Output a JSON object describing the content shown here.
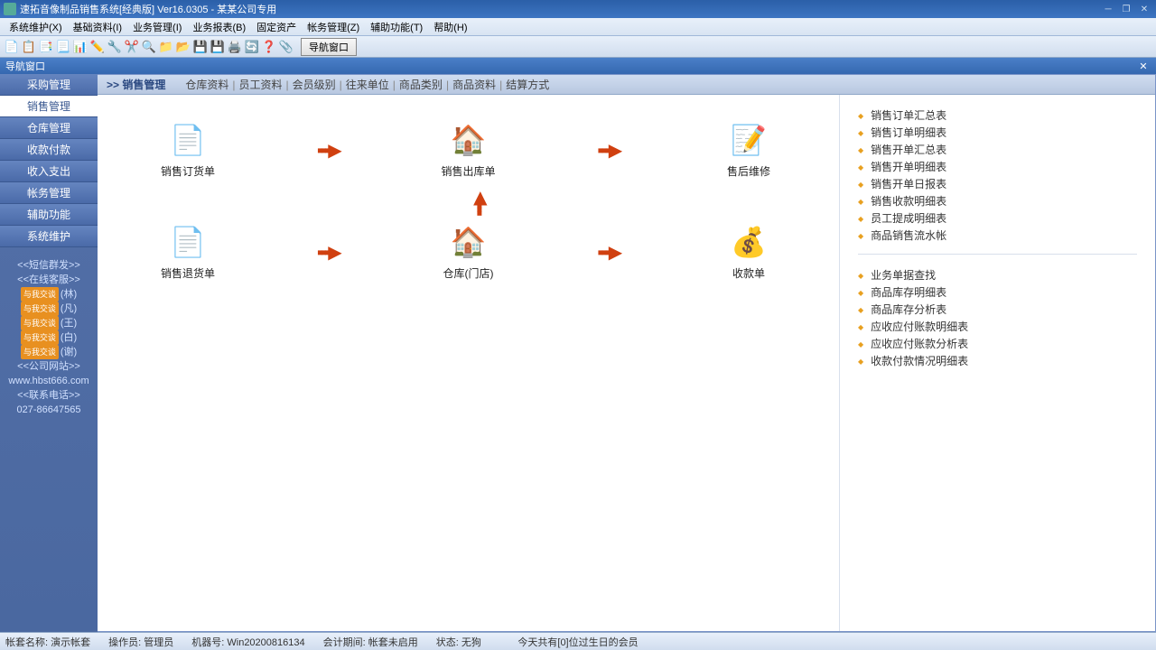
{
  "title": "速拓音像制品销售系统[经典版] Ver16.0305  -  某某公司专用",
  "menu": [
    "系统维护(X)",
    "基础资料(I)",
    "业务管理(I)",
    "业务报表(B)",
    "固定资产",
    "帐务管理(Z)",
    "辅助功能(T)",
    "帮助(H)"
  ],
  "nav_button": "导航窗口",
  "subheader": "导航窗口",
  "sidebar": [
    "采购管理",
    "销售管理",
    "仓库管理",
    "收款付款",
    "收入支出",
    "帐务管理",
    "辅助功能",
    "系统维护"
  ],
  "sidebar_active": 1,
  "side_extras": {
    "sms": "<<短信群发>>",
    "online": "<<在线客服>>",
    "chats": [
      "(林)",
      "(凡)",
      "(王)",
      "(白)",
      "(谢)"
    ],
    "chat_badge": "与我交谈",
    "website_label": "<<公司网站>>",
    "website_url": "www.hbst666.com",
    "phone_label": "<<联系电话>>",
    "phone": "027-86647565"
  },
  "content_tab_main": ">> 销售管理",
  "content_sub_tabs": [
    "仓库资料",
    "员工资料",
    "会员级别",
    "往来单位",
    "商品类别",
    "商品资料",
    "结算方式"
  ],
  "flow": {
    "row1": [
      {
        "label": "销售订货单",
        "icon": "📄"
      },
      {
        "label": "销售出库单",
        "icon": "🏠"
      },
      {
        "label": "售后维修",
        "icon": "📝"
      }
    ],
    "row2": [
      {
        "label": "销售退货单",
        "icon": "📄"
      },
      {
        "label": "仓库(门店)",
        "icon": "🏠"
      },
      {
        "label": "收款单",
        "icon": "💰"
      }
    ]
  },
  "right_group1": [
    "销售订单汇总表",
    "销售订单明细表",
    "销售开单汇总表",
    "销售开单明细表",
    "销售开单日报表",
    "销售收款明细表",
    "员工提成明细表",
    "商品销售流水帐"
  ],
  "right_group2": [
    "业务单据查找",
    "商品库存明细表",
    "商品库存分析表",
    "应收应付账款明细表",
    "应收应付账款分析表",
    "收款付款情况明细表"
  ],
  "status": {
    "account_label": "帐套名称:",
    "account": "演示帐套",
    "operator_label": "操作员:",
    "operator": "管理员",
    "machine_label": "机器号:",
    "machine": "Win20200816134",
    "period_label": "会计期间:",
    "period": "帐套未启用",
    "state_label": "状态:",
    "state": "无狗",
    "birthday": "今天共有[0]位过生日的会员"
  }
}
